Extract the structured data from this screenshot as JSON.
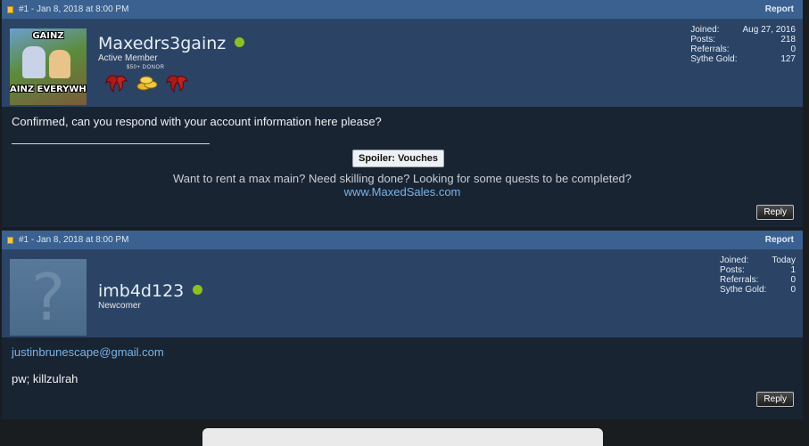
{
  "posts": [
    {
      "header": {
        "meta": "#1 - Jan 8, 2018 at 8:00 PM",
        "report_label": "Report"
      },
      "user": {
        "avatar_icon": "meme-avatar-icon",
        "avatar_text_top": "GAINZ",
        "avatar_text_bottom": "AINZ EVERYWHER",
        "username": "Maxedrs3gainz",
        "online": true,
        "title": "Active Member",
        "donor_label": "$50+ DONOR",
        "stats": [
          {
            "label": "Joined:",
            "value": "Aug 27, 2016"
          },
          {
            "label": "Posts:",
            "value": "218"
          },
          {
            "label": "Referrals:",
            "value": "0"
          },
          {
            "label": "Sythe Gold:",
            "value": "127"
          }
        ]
      },
      "body": {
        "text": "Confirmed, can you respond with your account information here please?",
        "spoiler_label": "Spoiler: Vouches",
        "signature_text": "Want to rent a max main? Need skilling done? Looking for some quests to be completed?",
        "signature_link": "www.MaxedSales.com"
      },
      "reply_label": "Reply"
    },
    {
      "header": {
        "meta": "#1 - Jan 8, 2018 at 8:00 PM",
        "report_label": "Report"
      },
      "user": {
        "avatar_icon": "default-avatar-icon",
        "username": "imb4d123",
        "online": true,
        "title": "Newcomer",
        "stats": [
          {
            "label": "Joined:",
            "value": "Today"
          },
          {
            "label": "Posts:",
            "value": "1"
          },
          {
            "label": "Referrals:",
            "value": "0"
          },
          {
            "label": "Sythe Gold:",
            "value": "0"
          }
        ]
      },
      "body": {
        "email": "justinbrunescape@gmail.com",
        "text": "pw; killzulrah"
      },
      "reply_label": "Reply"
    }
  ],
  "colors": {
    "header_bg": "#3a6190",
    "user_panel_bg": "#2b4466",
    "post_body_bg": "#192433",
    "online_dot": "#8ec21a",
    "link": "#79b3e6"
  }
}
